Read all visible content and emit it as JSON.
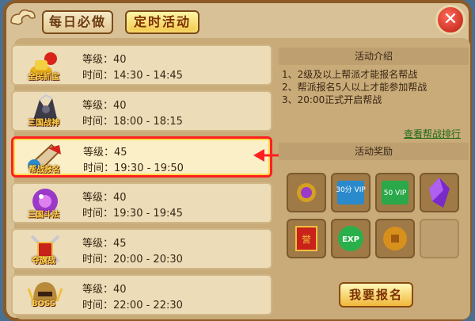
{
  "tabs": {
    "daily": "每日必做",
    "timed": "定时活动"
  },
  "close_label": "✕",
  "activities": [
    {
      "name": "全民抓宝",
      "level_label": "等级：40",
      "time_label": "时间：14:30 - 14:45",
      "icon": "gold-treasure-icon"
    },
    {
      "name": "三国战神",
      "level_label": "等级：40",
      "time_label": "时间：18:00 - 18:15",
      "icon": "war-god-icon"
    },
    {
      "name": "帮战报名",
      "level_label": "等级：45",
      "time_label": "时间：19:30 - 19:50",
      "icon": "guild-horn-icon",
      "selected": true
    },
    {
      "name": "三国斗法",
      "level_label": "等级：40",
      "time_label": "时间：19:30 - 19:45",
      "icon": "purple-orb-icon"
    },
    {
      "name": "夺旗战",
      "level_label": "等级：45",
      "time_label": "时间：20:00 - 20:30",
      "icon": "crossed-swords-icon"
    },
    {
      "name": "BOSS",
      "level_label": "等级：40",
      "time_label": "时间：22:00 - 22:30",
      "icon": "boss-helmet-icon"
    }
  ],
  "panel": {
    "intro_title": "活动介绍",
    "intro_lines": [
      "1、2级及以上帮派才能报名帮战",
      "2、帮派报名5人以上才能参加帮战",
      "3、20:00正式开启帮战"
    ],
    "rank_link": "查看帮战排行",
    "reward_title": "活动奖励",
    "rewards": [
      {
        "icon": "purple-amulet-icon",
        "label": ""
      },
      {
        "icon": "vip-card-icon",
        "label": "30分 VIP"
      },
      {
        "icon": "vip-card-icon",
        "label": "50 VIP"
      },
      {
        "icon": "purple-crystal-icon",
        "label": ""
      },
      {
        "icon": "red-banner-icon",
        "label": "誉"
      },
      {
        "icon": "exp-orb-icon",
        "label": "EXP"
      },
      {
        "icon": "copper-coin-icon",
        "label": ""
      },
      {
        "icon": "empty-slot",
        "label": ""
      }
    ],
    "signup_label": "我要报名"
  },
  "colors": {
    "accent": "#ff2020",
    "highlight": "#ffd84a"
  }
}
